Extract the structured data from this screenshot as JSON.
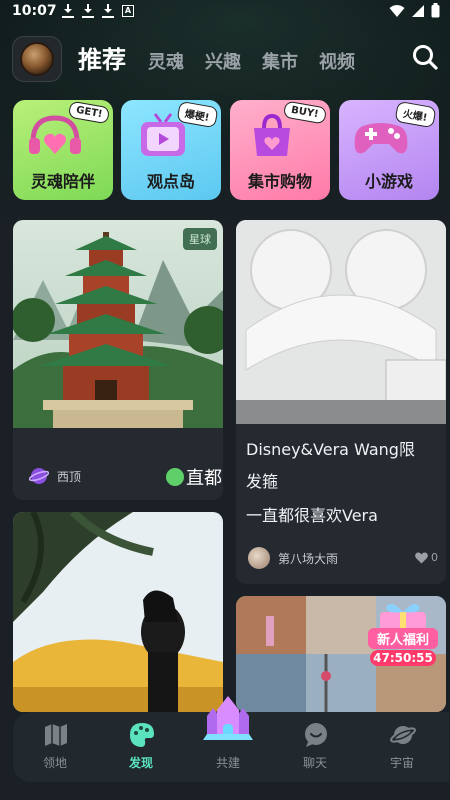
{
  "status_bar": {
    "time": "10:07",
    "app_icon_letter": "A"
  },
  "header": {
    "tabs": [
      {
        "label": "推荐",
        "active": true
      },
      {
        "label": "灵魂",
        "active": false
      },
      {
        "label": "兴趣",
        "active": false
      },
      {
        "label": "集市",
        "active": false
      },
      {
        "label": "视频",
        "active": false
      }
    ]
  },
  "features": [
    {
      "label": "灵魂陪伴",
      "badge": "GET!",
      "color": "#9ee86a"
    },
    {
      "label": "观点岛",
      "badge": "爆梗!",
      "color": "#7fd8f0"
    },
    {
      "label": "集市购物",
      "badge": "BUY!",
      "color": "#ff8fb8"
    },
    {
      "label": "小游戏",
      "badge": "火爆!",
      "color": "#c79cf5"
    }
  ],
  "feed": {
    "left": [
      {
        "tag": "星球",
        "user": "西顶",
        "overlay_text": "直都"
      }
    ],
    "right": [
      {
        "text_line1": "Disney&Vera Wang限",
        "text_line2": "发箍",
        "text_line3": "一直都很喜欢Vera",
        "user": "第八场大雨",
        "likes": "0"
      },
      {
        "banner_title": "新人福利",
        "countdown": "47:50:55"
      }
    ]
  },
  "bottom_nav": [
    {
      "label": "领地",
      "icon": "map-icon",
      "active": false
    },
    {
      "label": "发现",
      "icon": "palette-icon",
      "active": true
    },
    {
      "label": "共建",
      "icon": "castle-icon",
      "active": false
    },
    {
      "label": "聊天",
      "icon": "chat-bubble-icon",
      "active": false
    },
    {
      "label": "宇宙",
      "icon": "planet-icon",
      "active": false
    }
  ],
  "colors": {
    "background": "#1a2026",
    "card": "#242a30",
    "accent": "#5be3c0"
  }
}
